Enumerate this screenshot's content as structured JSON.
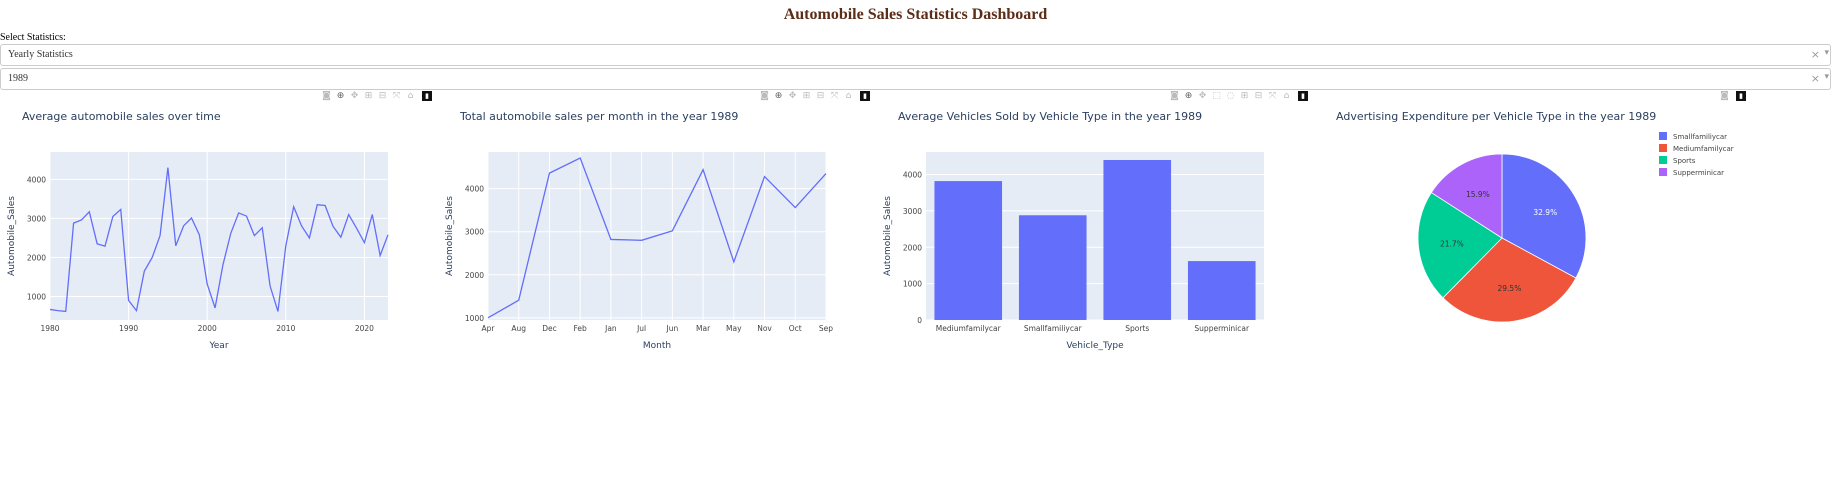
{
  "header": {
    "title": "Automobile Sales Statistics Dashboard"
  },
  "controls": {
    "select_label": "Select Statistics:",
    "statistics_dropdown": {
      "value": "Yearly Statistics"
    },
    "year_dropdown": {
      "value": "1989"
    },
    "clear_glyph": "×",
    "arrow_glyph": "▾"
  },
  "colors": {
    "plot_bg": "#e5ecf6",
    "line": "#636efa",
    "bar": "#636efa",
    "pie": [
      "#636efa",
      "#ef553b",
      "#00cc96",
      "#ab63fa"
    ]
  },
  "chart_data": [
    {
      "type": "line",
      "title": "Average automobile sales over time",
      "xlabel": "Year",
      "ylabel": "Automobile_Sales",
      "xlim": [
        1980,
        2023
      ],
      "ylim": [
        400,
        4700
      ],
      "xticks": [
        1980,
        1990,
        2000,
        2010,
        2020
      ],
      "yticks": [
        1000,
        2000,
        3000,
        4000
      ],
      "x": [
        1980,
        1981,
        1982,
        1983,
        1984,
        1985,
        1986,
        1987,
        1988,
        1989,
        1990,
        1991,
        1992,
        1993,
        1994,
        1995,
        1996,
        1997,
        1998,
        1999,
        2000,
        2001,
        2002,
        2003,
        2004,
        2005,
        2006,
        2007,
        2008,
        2009,
        2010,
        2011,
        2012,
        2013,
        2014,
        2015,
        2016,
        2017,
        2018,
        2019,
        2020,
        2021,
        2022,
        2023
      ],
      "values": [
        670,
        640,
        620,
        2880,
        2960,
        3170,
        2350,
        2290,
        3050,
        3230,
        900,
        640,
        1650,
        2000,
        2560,
        4300,
        2300,
        2810,
        3010,
        2580,
        1320,
        710,
        1810,
        2620,
        3140,
        3060,
        2560,
        2760,
        1270,
        620,
        2300,
        3300,
        2810,
        2500,
        3350,
        3330,
        2800,
        2520,
        3100,
        2750,
        2380,
        3100,
        2050,
        2580
      ]
    },
    {
      "type": "line",
      "title": "Total automobile sales per month in the year 1989",
      "xlabel": "Month",
      "ylabel": "Automobile_Sales",
      "ylim": [
        950,
        4850
      ],
      "yticks": [
        1000,
        2000,
        3000,
        4000
      ],
      "categories": [
        "Apr",
        "Aug",
        "Dec",
        "Feb",
        "Jan",
        "Jul",
        "Jun",
        "Mar",
        "May",
        "Nov",
        "Oct",
        "Sep"
      ],
      "values": [
        1000,
        1410,
        4360,
        4710,
        2820,
        2800,
        3020,
        4440,
        2300,
        4280,
        3560,
        4350
      ]
    },
    {
      "type": "bar",
      "title": "Average Vehicles Sold by Vehicle Type in the year 1989",
      "xlabel": "Vehicle_Type",
      "ylabel": "Automobile_Sales",
      "ylim": [
        0,
        4620
      ],
      "yticks": [
        0,
        1000,
        2000,
        3000,
        4000
      ],
      "categories": [
        "Mediumfamilycar",
        "Smallfamiliycar",
        "Sports",
        "Supperminicar"
      ],
      "values": [
        3820,
        2880,
        4400,
        1620
      ]
    },
    {
      "type": "pie",
      "title": "Advertising Expenditure per Vehicle Type in the year 1989",
      "labels": [
        "Smallfamiliycar",
        "Mediumfamilycar",
        "Sports",
        "Supperminicar"
      ],
      "values": [
        32.9,
        29.5,
        21.7,
        15.9
      ],
      "text_labels": [
        "32.9%",
        "29.5%",
        "21.7%",
        "15.9%"
      ],
      "legend": "right"
    }
  ]
}
